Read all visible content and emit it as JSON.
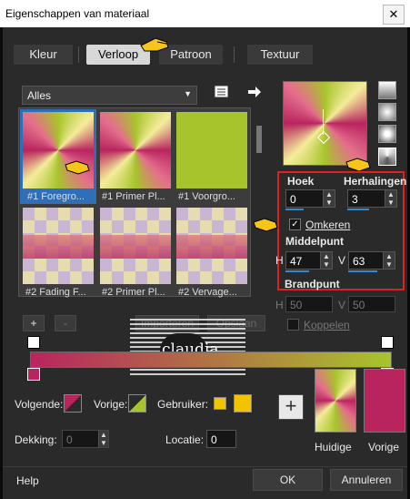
{
  "window": {
    "title": "Eigenschappen van materiaal",
    "close_label": "✕"
  },
  "tabs": [
    {
      "label": "Kleur",
      "active": false
    },
    {
      "label": "Verloop",
      "active": true
    },
    {
      "label": "Patroon",
      "active": false
    },
    {
      "label": "Textuur",
      "active": false
    }
  ],
  "category": {
    "selected": "Alles"
  },
  "thumbnails": [
    {
      "label": "#1 Foregro...",
      "style": "sunburst",
      "selected": true
    },
    {
      "label": "#1 Primer Pl...",
      "style": "sunburst",
      "selected": false
    },
    {
      "label": "#1 Voorgro...",
      "style": "solid",
      "selected": false
    },
    {
      "label": "#2 Fading F...",
      "style": "checker",
      "selected": false
    },
    {
      "label": "#2 Primer Pl...",
      "style": "checker",
      "selected": false
    },
    {
      "label": "#2 Vervage...",
      "style": "checker",
      "selected": false
    }
  ],
  "thumb_buttons": {
    "add": "+",
    "remove": "-",
    "import": "Importeren",
    "export": "Opslaan"
  },
  "gradient_props": {
    "hoek_label": "Hoek",
    "hoek_value": "0",
    "herhalingen_label": "Herhalingen",
    "herhalingen_value": "3",
    "omkeren_label": "Omkeren",
    "omkeren_checked": true,
    "middelpunt_label": "Middelpunt",
    "h_label": "H",
    "h_value": "47",
    "v_label": "V",
    "v_value": "63",
    "brandpunt_label": "Brandpunt",
    "bh_label": "H",
    "bh_value": "50",
    "bv_label": "V",
    "bv_value": "50",
    "koppelen_label": "Koppelen"
  },
  "styles": {
    "colors": {
      "pink": "#b9245f",
      "lime": "#a8c42c",
      "yellow": "#f2c400",
      "cream": "#e6dcb0"
    }
  },
  "watermark": {
    "text": "claudia",
    "subtext": "tutorials"
  },
  "colorpick": {
    "volgende_label": "Volgende:",
    "vorige_label": "Vorige:",
    "gebruiker_label": "Gebruiker:",
    "dekking_label": "Dekking:",
    "dekking_value": "0",
    "locatie_label": "Locatie:",
    "locatie_value": "0"
  },
  "current": {
    "huidige_label": "Huidige",
    "vorige_label": "Vorige",
    "add_label": "+"
  },
  "footer": {
    "help": "Help",
    "ok": "OK",
    "cancel": "Annuleren"
  }
}
